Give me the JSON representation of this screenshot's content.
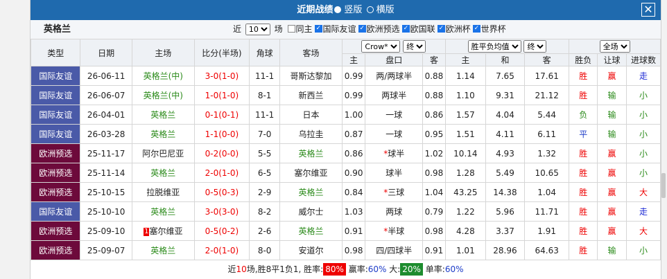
{
  "title": "近期战绩",
  "mode_vertical": "竖版",
  "mode_horizontal": "横版",
  "close": "✕",
  "team": "英格兰",
  "filter": {
    "near": "近",
    "count": "10",
    "unit": "场",
    "same_home": "同主",
    "leagues": [
      "国际友谊",
      "欧洲预选",
      "欧国联",
      "欧洲杯",
      "世界杯"
    ]
  },
  "headers": {
    "type": "类型",
    "date": "日期",
    "home": "主场",
    "score": "比分(半场)",
    "corner": "角球",
    "away": "客场",
    "company": "Crow*",
    "final1": "终",
    "avg": "胜平负均值",
    "final2": "终",
    "scope": "全场",
    "sub_home": "主",
    "sub_handicap": "盘口",
    "sub_away": "客",
    "sub_home2": "主",
    "sub_draw": "和",
    "sub_away2": "客",
    "result": "胜负",
    "handicap_res": "让球",
    "goals": "进球数"
  },
  "rows": [
    {
      "type": "国际友谊",
      "cat": "friendly",
      "date": "26-06-11",
      "home": "英格兰(中)",
      "badge": "",
      "score": "3-0(1-0)",
      "corner": "11-1",
      "away": "哥斯达黎加",
      "h": "0.99",
      "pan": "两/两球半",
      "a": "0.88",
      "w": "1.14",
      "d": "7.65",
      "l": "17.61",
      "res": "胜",
      "hc": "赢",
      "gl": "走"
    },
    {
      "type": "国际友谊",
      "cat": "friendly",
      "date": "26-06-07",
      "home": "英格兰(中)",
      "badge": "",
      "score": "1-0(1-0)",
      "corner": "8-1",
      "away": "新西兰",
      "h": "0.99",
      "pan": "两球半",
      "a": "0.88",
      "w": "1.10",
      "d": "9.31",
      "l": "21.12",
      "res": "胜",
      "hc": "输",
      "gl": "小"
    },
    {
      "type": "国际友谊",
      "cat": "friendly",
      "date": "26-04-01",
      "home": "英格兰",
      "badge": "",
      "score": "0-1(0-1)",
      "corner": "11-1",
      "away": "日本",
      "h": "1.00",
      "pan": "一球",
      "a": "0.86",
      "w": "1.57",
      "d": "4.04",
      "l": "5.44",
      "res": "负",
      "hc": "输",
      "gl": "小"
    },
    {
      "type": "国际友谊",
      "cat": "friendly",
      "date": "26-03-28",
      "home": "英格兰",
      "badge": "",
      "score": "1-1(0-0)",
      "corner": "7-0",
      "away": "乌拉圭",
      "h": "0.87",
      "pan": "一球",
      "a": "0.95",
      "w": "1.51",
      "d": "4.11",
      "l": "6.11",
      "res": "平",
      "hc": "输",
      "gl": "小"
    },
    {
      "type": "欧洲预选",
      "cat": "euro",
      "date": "25-11-17",
      "home": "阿尔巴尼亚",
      "badge": "",
      "score": "0-2(0-0)",
      "corner": "5-5",
      "away": "英格兰",
      "h": "0.86",
      "pan": "*球半",
      "a": "1.02",
      "w": "10.14",
      "d": "4.93",
      "l": "1.32",
      "res": "胜",
      "hc": "赢",
      "gl": "小"
    },
    {
      "type": "欧洲预选",
      "cat": "euro",
      "date": "25-11-14",
      "home": "英格兰",
      "badge": "",
      "score": "2-0(1-0)",
      "corner": "6-5",
      "away": "塞尔维亚",
      "h": "0.90",
      "pan": "球半",
      "a": "0.98",
      "w": "1.28",
      "d": "5.49",
      "l": "10.65",
      "res": "胜",
      "hc": "赢",
      "gl": "小"
    },
    {
      "type": "欧洲预选",
      "cat": "euro",
      "date": "25-10-15",
      "home": "拉脱维亚",
      "badge": "",
      "score": "0-5(0-3)",
      "corner": "2-9",
      "away": "英格兰",
      "h": "0.84",
      "pan": "*三球",
      "a": "1.04",
      "w": "43.25",
      "d": "14.38",
      "l": "1.04",
      "res": "胜",
      "hc": "赢",
      "gl": "大"
    },
    {
      "type": "国际友谊",
      "cat": "friendly",
      "date": "25-10-10",
      "home": "英格兰",
      "badge": "",
      "score": "3-0(3-0)",
      "corner": "8-2",
      "away": "威尔士",
      "h": "1.03",
      "pan": "两球",
      "a": "0.79",
      "w": "1.22",
      "d": "5.96",
      "l": "11.71",
      "res": "胜",
      "hc": "赢",
      "gl": "走"
    },
    {
      "type": "欧洲预选",
      "cat": "euro",
      "date": "25-09-10",
      "home": "塞尔维亚",
      "badge": "1",
      "score": "0-5(0-2)",
      "corner": "2-6",
      "away": "英格兰",
      "h": "0.91",
      "pan": "*半球",
      "a": "0.98",
      "w": "4.28",
      "d": "3.37",
      "l": "1.91",
      "res": "胜",
      "hc": "赢",
      "gl": "大"
    },
    {
      "type": "欧洲预选",
      "cat": "euro",
      "date": "25-09-07",
      "home": "英格兰",
      "badge": "",
      "score": "2-0(1-0)",
      "corner": "8-0",
      "away": "安道尔",
      "h": "0.98",
      "pan": "四/四球半",
      "a": "0.91",
      "w": "1.01",
      "d": "28.96",
      "l": "64.63",
      "res": "胜",
      "hc": "输",
      "gl": "小"
    }
  ],
  "footer": {
    "prefix": "近",
    "games": "10",
    "summary": "场,胜8平1负1, 胜率:",
    "win_rate": "80%",
    "ying_label": "赢率:",
    "ying_rate": "60%",
    "big_label": "大:",
    "big_rate": "20%",
    "odd_label": "单率:",
    "odd_rate": "60%"
  }
}
